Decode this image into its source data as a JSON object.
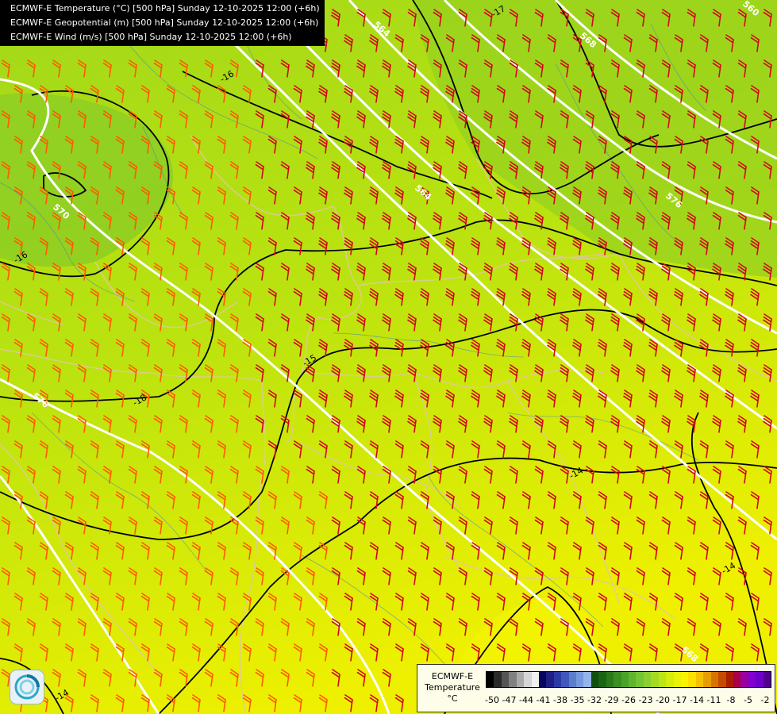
{
  "header": {
    "lines": [
      "ECMWF-E Temperature (°C) [500 hPa] Sunday 12-10-2025 12:00 (+6h)",
      "ECMWF-E Geopotential (m) [500 hPa] Sunday 12-10-2025 12:00 (+6h)",
      "ECMWF-E Wind (m/s) [500 hPa] Sunday 12-10-2025 12:00 (+6h)"
    ]
  },
  "colorbar": {
    "title_lines": [
      "ECMWF-E",
      "Temperature",
      "°C"
    ],
    "ticks": [
      "-50",
      "-47",
      "-44",
      "-41",
      "-38",
      "-35",
      "-32",
      "-29",
      "-26",
      "-23",
      "-20",
      "-17",
      "-14",
      "-11",
      "-8",
      "-5",
      "-2"
    ],
    "colors": [
      "#000000",
      "#2a2a2a",
      "#555555",
      "#808080",
      "#aaaaaa",
      "#d5d5d5",
      "#f0f0f0",
      "#06065c",
      "#1e1e86",
      "#2d39a6",
      "#4158bb",
      "#5a7dcc",
      "#7698dc",
      "#93b5e9",
      "#0f4f0f",
      "#1b6414",
      "#2a7a1c",
      "#3a8e22",
      "#4ba229",
      "#5fb52f",
      "#75c433",
      "#8ccf30",
      "#a4da22",
      "#bce516",
      "#d4ed0c",
      "#eaf206",
      "#f8f400",
      "#fde000",
      "#f4c000",
      "#e79c00",
      "#d67400",
      "#c44a00",
      "#aa1e00",
      "#a8004a",
      "#9a00a0",
      "#8000d0",
      "#6d00c8",
      "#50008c"
    ]
  },
  "map": {
    "contours_geopotential": {
      "labels": [
        "560",
        "564",
        "568",
        "564",
        "570",
        "576",
        "576",
        "568"
      ]
    },
    "contours_temperature": {
      "labels": [
        "-17",
        "-16",
        "-18",
        "-15",
        "-16",
        "-14",
        "-14",
        "-14"
      ]
    },
    "wind_barb_colors": {
      "strong": "#d0091a",
      "moderate": "#ff5a00"
    },
    "temperature_fill_colors": [
      "#8ccf30",
      "#a4da22",
      "#bce516",
      "#d4ed0c",
      "#eaf206"
    ]
  },
  "logo": {
    "icon": "ecmwf-logo-icon"
  }
}
